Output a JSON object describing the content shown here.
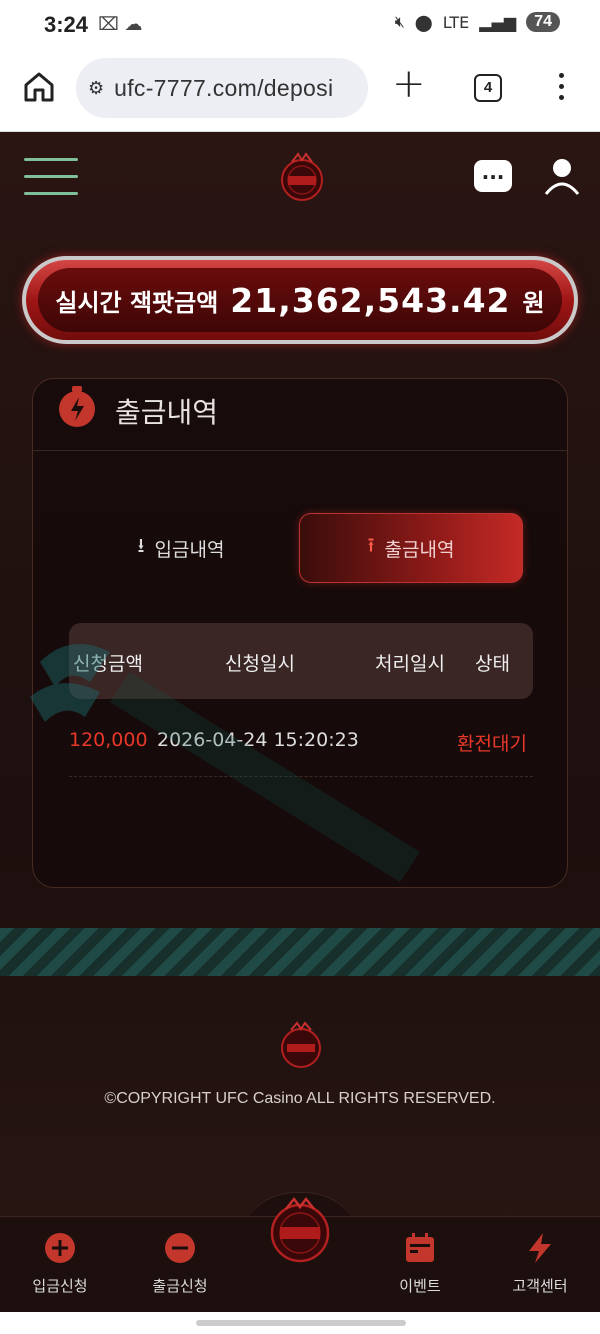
{
  "status_bar": {
    "time": "3:24",
    "network": "LTE",
    "battery": "74"
  },
  "browser": {
    "url": "ufc-7777.com/deposi",
    "tab_count": "4"
  },
  "header": {
    "logo_name": "UFC",
    "chat_icon_text": "..."
  },
  "jackpot": {
    "label": "실시간 잭팟금액",
    "value": "21,362,543.42",
    "unit": "원"
  },
  "card": {
    "title": "출금내역",
    "tabs": [
      {
        "label": "입금내역",
        "active": false
      },
      {
        "label": "출금내역",
        "active": true
      }
    ],
    "columns": [
      "신청금액",
      "신청일시",
      "처리일시",
      "상태"
    ],
    "rows": [
      {
        "amount": "120,000",
        "requested_at": "2026-04-24 15:20:23",
        "processed_at": "",
        "status": "환전대기"
      }
    ]
  },
  "footer": {
    "copyright": "©COPYRIGHT UFC Casino ALL RIGHTS RESERVED."
  },
  "bottom_nav": [
    {
      "label": "입금신청",
      "icon": "plus-circle-icon"
    },
    {
      "label": "출금신청",
      "icon": "minus-circle-icon"
    },
    {
      "label": "",
      "icon": "ufc-logo-icon"
    },
    {
      "label": "이벤트",
      "icon": "calendar-icon"
    },
    {
      "label": "고객센터",
      "icon": "lightning-icon"
    }
  ],
  "colors": {
    "accent_red": "#e8382a",
    "background": "#1a0d0b",
    "band_green": "#1f4a45"
  }
}
